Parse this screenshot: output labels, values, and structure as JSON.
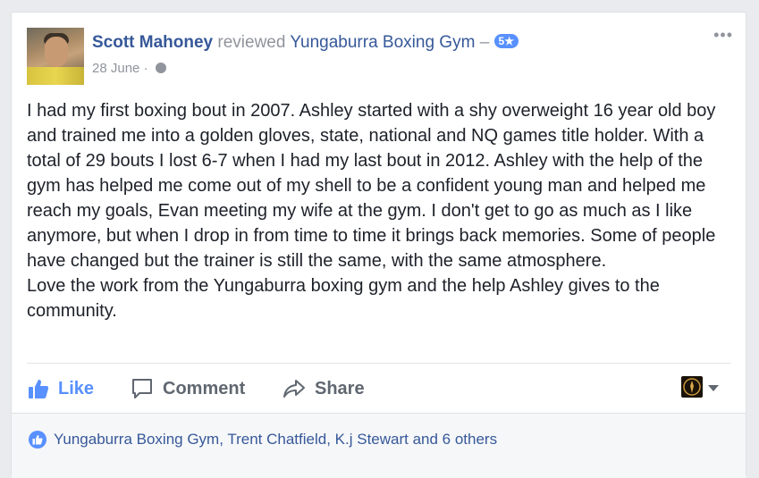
{
  "post": {
    "author": "Scott Mahoney",
    "action_text": "reviewed",
    "page_name": "Yungaburra Boxing Gym",
    "dash": "–",
    "rating": "5★",
    "date": "28 June",
    "separator": "·",
    "body_paragraphs": [
      "I had my first boxing bout in 2007. Ashley started with a shy overweight 16 year old boy and trained me into a golden gloves, state, national and NQ games title holder. With a total of 29 bouts I lost 6-7 when I had my last bout in 2012. Ashley with the help of the gym has helped me come out of my shell to be a confident young man and helped me reach my goals, Evan meeting my wife at the gym. I don't get to go as much as I like anymore, but when I drop in from time to time it brings back memories. Some of people have changed but the trainer is still the same, with the same atmosphere.",
      "Love the work from the Yungaburra boxing gym and the help Ashley gives to the community."
    ]
  },
  "actions": {
    "like_label": "Like",
    "comment_label": "Comment",
    "share_label": "Share"
  },
  "footer": {
    "likes_text": "Yungaburra Boxing Gym, Trent Chatfield, K.j Stewart and 6 others"
  },
  "colors": {
    "link_blue": "#365899",
    "accent_blue": "#5890ff",
    "muted_gray": "#90949c",
    "text_dark": "#1d2129"
  },
  "icons": {
    "avatar": "profile-photo",
    "more": "more-options-icon",
    "globe": "public-globe-icon",
    "like": "thumbs-up-icon",
    "comment": "comment-bubble-icon",
    "share": "share-arrow-icon",
    "page_avatar": "page-profile-icon",
    "caret": "chevron-down-icon"
  }
}
